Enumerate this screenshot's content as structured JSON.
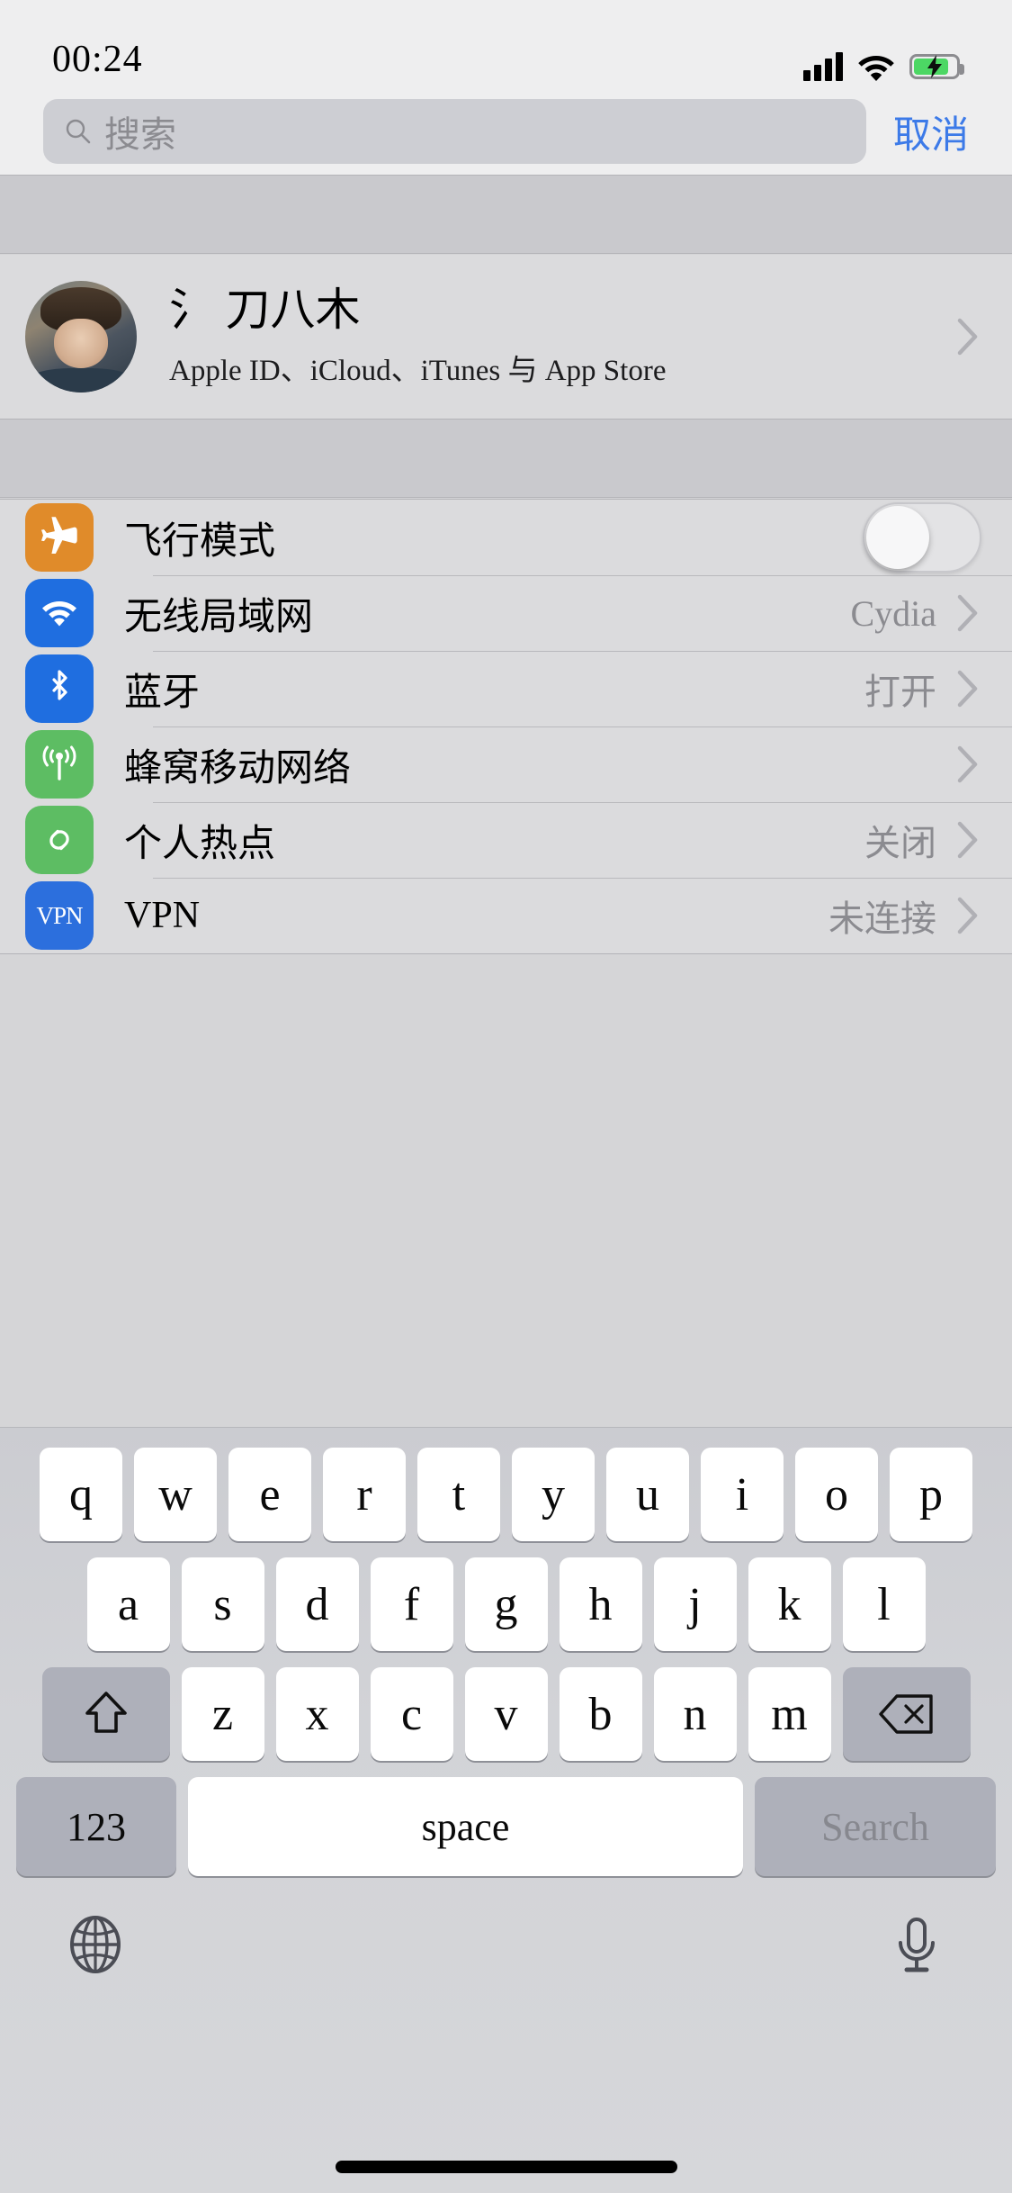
{
  "status_bar": {
    "time": "00:24",
    "signal_icon": "cellular-signal-icon",
    "wifi_icon": "wifi-icon",
    "battery_icon": "battery-charging-icon"
  },
  "search": {
    "placeholder": "搜索",
    "value": "",
    "cancel_label": "取消",
    "search_icon": "search-icon"
  },
  "profile": {
    "name": "氵 刀八木",
    "subtitle": "Apple ID、iCloud、iTunes 与 App Store",
    "avatar_icon": "avatar",
    "chevron_icon": "chevron-right-icon"
  },
  "settings_rows": [
    {
      "key": "airplane-mode",
      "label": "飞行模式",
      "icon": "airplane-icon",
      "icon_color": "#e08b2a",
      "control": "toggle",
      "toggle_on": false,
      "value": ""
    },
    {
      "key": "wifi",
      "label": "无线局域网",
      "icon": "wifi-icon",
      "icon_color": "#1f6ee0",
      "control": "disclosure",
      "value": "Cydia"
    },
    {
      "key": "bluetooth",
      "label": "蓝牙",
      "icon": "bluetooth-icon",
      "icon_color": "#1f6ee0",
      "control": "disclosure",
      "value": "打开"
    },
    {
      "key": "cellular",
      "label": "蜂窝移动网络",
      "icon": "cellular-antenna-icon",
      "icon_color": "#5dbd63",
      "control": "disclosure",
      "value": ""
    },
    {
      "key": "personal-hotspot",
      "label": "个人热点",
      "icon": "hotspot-link-icon",
      "icon_color": "#5dbd63",
      "control": "disclosure",
      "value": "关闭"
    },
    {
      "key": "vpn",
      "label": "VPN",
      "icon": "vpn-icon",
      "icon_color": "#2c6fdd",
      "icon_text": "VPN",
      "control": "disclosure",
      "value": "未连接"
    }
  ],
  "keyboard": {
    "row1": [
      "q",
      "w",
      "e",
      "r",
      "t",
      "y",
      "u",
      "i",
      "o",
      "p"
    ],
    "row2": [
      "a",
      "s",
      "d",
      "f",
      "g",
      "h",
      "j",
      "k",
      "l"
    ],
    "row3": [
      "z",
      "x",
      "c",
      "v",
      "b",
      "n",
      "m"
    ],
    "shift_icon": "shift-arrow-icon",
    "backspace_icon": "backspace-delete-icon",
    "numbers_label": "123",
    "space_label": "space",
    "return_label": "Search",
    "globe_icon": "globe-icon",
    "mic_icon": "microphone-icon"
  },
  "colors": {
    "accent_blue": "#3c7ae8",
    "background": "#d5d5d7",
    "statusbar_bg": "#eeeeef",
    "list_bg": "#dbdbdd",
    "spacer_bg": "#c9c9cd",
    "battery_green": "#4cd764"
  }
}
